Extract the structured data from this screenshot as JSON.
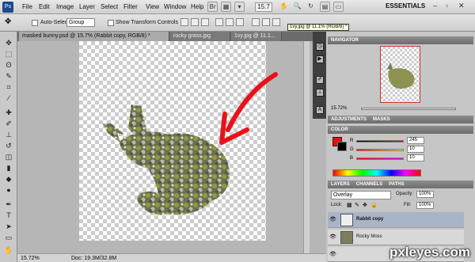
{
  "menubar": {
    "logo": "Ps",
    "items": [
      "File",
      "Edit",
      "Image",
      "Layer",
      "Select",
      "Filter",
      "View",
      "Window",
      "Help"
    ],
    "zoom_value": "15.7",
    "workspace": "ESSENTIALS"
  },
  "options_bar": {
    "auto_select_label": "Auto-Select:",
    "auto_select_value": "Group",
    "show_transform_label": "Show Transform Controls"
  },
  "tabs": [
    {
      "label": "masked bunny.psd @ 15.7% (Rabbit copy, RGB/8) *",
      "active": true
    },
    {
      "label": "rocky grass.jpg",
      "active": false
    },
    {
      "label": "1vy.jpg @ 11.1...",
      "active": false
    }
  ],
  "tooltip": "1vy.jpg @ 11.1% (RGB/8) *",
  "status": {
    "zoom": "15.72%",
    "doc": "Doc: 19.3M/32.8M"
  },
  "navigator": {
    "title": "NAVIGATOR",
    "zoom": "15.72%"
  },
  "adjustments": {
    "tabs": [
      "ADJUSTMENTS",
      "MASKS"
    ]
  },
  "color": {
    "title": "COLOR",
    "channels": [
      {
        "label": "R",
        "value": "245"
      },
      {
        "label": "G",
        "value": "10"
      },
      {
        "label": "B",
        "value": "10"
      }
    ],
    "fg_color": "#f50a0a",
    "bg_color": "#000000"
  },
  "layers": {
    "tabs": [
      "LAYERS",
      "CHANNELS",
      "PATHS"
    ],
    "blend_mode": "Overlay",
    "opacity_label": "Opacity:",
    "opacity_value": "100%",
    "lock_label": "Lock:",
    "fill_label": "Fill:",
    "fill_value": "100%",
    "items": [
      {
        "name": "Rabbit copy",
        "selected": true
      },
      {
        "name": "Rocky Moss",
        "selected": false
      }
    ]
  },
  "watermark": "pxleyes.com",
  "accent_colors": {
    "arrow": "#e8121b"
  }
}
